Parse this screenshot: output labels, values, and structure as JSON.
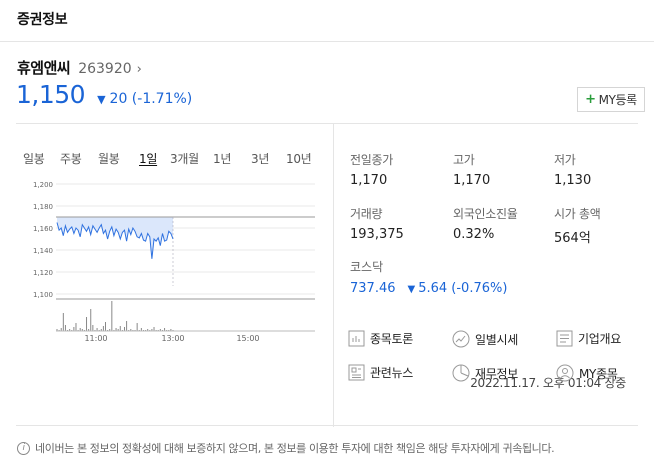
{
  "header": {
    "title": "증권정보"
  },
  "stock": {
    "name": "휴엠앤씨",
    "code": "263920",
    "arrow": "›",
    "price": "1,150",
    "change_arrow": "▼",
    "change": "20 (-1.71%)",
    "my_button": {
      "plus": "+",
      "label": "MY등록"
    }
  },
  "period_tabs": [
    "일봉",
    "주봉",
    "월봉",
    "1일",
    "3개월",
    "1년",
    "3년",
    "10년"
  ],
  "active_tab": "1일",
  "chart_data": {
    "type": "line",
    "y_ticks": [
      "1,200",
      "1,180",
      "1,160",
      "1,140",
      "1,120",
      "1,100"
    ],
    "x_ticks": [
      "11:00",
      "13:00",
      "15:00"
    ],
    "ylim": [
      1100,
      1200
    ],
    "previous_close": 1170,
    "price_series": [
      1165,
      1158,
      1160,
      1153,
      1162,
      1156,
      1159,
      1161,
      1155,
      1160,
      1158,
      1152,
      1163,
      1160,
      1157,
      1161,
      1154,
      1162,
      1159,
      1156,
      1160,
      1163,
      1155,
      1158,
      1150,
      1157,
      1161,
      1153,
      1159,
      1156,
      1150,
      1156,
      1158,
      1148,
      1159,
      1154,
      1160,
      1157,
      1152,
      1151,
      1155,
      1149,
      1148,
      1155,
      1152,
      1132,
      1150,
      1148,
      1151,
      1144,
      1155,
      1148,
      1149,
      1157,
      1155,
      1150
    ],
    "volume_series": [
      2,
      1,
      3,
      18,
      6,
      1,
      2,
      1,
      4,
      8,
      1,
      3,
      2,
      1,
      14,
      2,
      22,
      6,
      1,
      3,
      1,
      2,
      5,
      9,
      1,
      2,
      30,
      1,
      3,
      2,
      5,
      1,
      4,
      10,
      1,
      2,
      1,
      1,
      8,
      1,
      3,
      1,
      1,
      2,
      1,
      2,
      4,
      1,
      1,
      2,
      1,
      3,
      1,
      1,
      2,
      1
    ]
  },
  "timestamp": "2022.11.17. 오후 01:04 장중",
  "stats": [
    {
      "label": "전일종가",
      "value": "1,170"
    },
    {
      "label": "고가",
      "value": "1,170"
    },
    {
      "label": "저가",
      "value": "1,130"
    },
    {
      "label": "거래량",
      "value": "193,375"
    },
    {
      "label": "외국인소진율",
      "value": "0.32%"
    },
    {
      "label": "시가 총액",
      "value": "564억"
    }
  ],
  "index": {
    "label": "코스닥",
    "value": "737.46",
    "arrow": "▼",
    "change": "5.64 (-0.76%)"
  },
  "links": [
    {
      "label": "종목토론",
      "icon": "discussion-icon"
    },
    {
      "label": "일별시세",
      "icon": "daily-price-icon"
    },
    {
      "label": "기업개요",
      "icon": "company-overview-icon"
    },
    {
      "label": "관련뉴스",
      "icon": "news-icon"
    },
    {
      "label": "재무정보",
      "icon": "financial-icon"
    },
    {
      "label": "MY종목",
      "icon": "my-stock-icon"
    }
  ],
  "footer": {
    "text": "네이버는 본 정보의 정확성에 대해 보증하지 않으며, 본 정보를 이용한 투자에 대한 책임은 해당 투자자에게 귀속됩니다."
  },
  "colors": {
    "down": "#1a64d6",
    "up_plus": "#2a9d3c",
    "area_fill": "#dbe7fb",
    "line": "#2f72e0"
  }
}
